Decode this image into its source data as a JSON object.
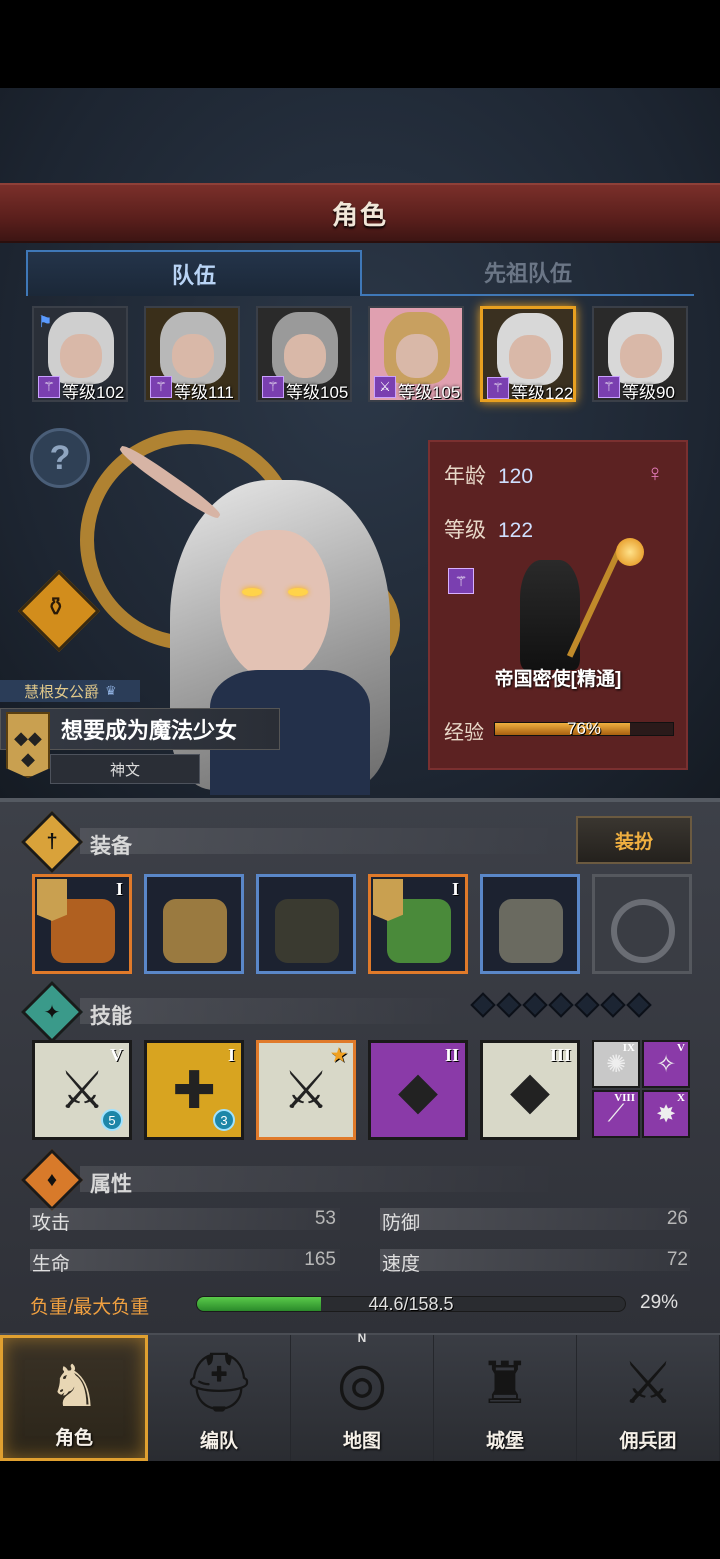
{
  "header": {
    "title": "角色"
  },
  "tabs": [
    {
      "label": "队伍",
      "active": true
    },
    {
      "label": "先祖队伍",
      "active": false
    }
  ],
  "party": [
    {
      "level": "等级102",
      "hair": "#cfcfcf",
      "bg": "#2a2f38",
      "flag": true,
      "class_icon": "staff-icon"
    },
    {
      "level": "等级111",
      "hair": "#b8b8b8",
      "bg": "#3a2f1a",
      "flag": false,
      "class_icon": "staff-icon"
    },
    {
      "level": "等级105",
      "hair": "#9a9a9a",
      "bg": "#2a2a2a",
      "flag": false,
      "class_icon": "staff-icon"
    },
    {
      "level": "等级105",
      "hair": "#c8a060",
      "bg": "#e0a0b0",
      "flag": false,
      "class_icon": "sword-icon"
    },
    {
      "level": "等级122",
      "hair": "#d8d8d8",
      "bg": "#3a3020",
      "flag": false,
      "class_icon": "staff-icon",
      "selected": true
    },
    {
      "level": "等级90",
      "hair": "#d8d8d8",
      "bg": "#2a2a2a",
      "flag": false,
      "class_icon": "staff-icon"
    }
  ],
  "character": {
    "title": "慧根女公爵",
    "trait": "想要成为魔法少女",
    "sub_trait": "神文",
    "age_label": "年龄",
    "age": "120",
    "level_label": "等级",
    "level": "122",
    "gender_icon": "female-icon",
    "job": "帝国密使[精通]",
    "exp_label": "经验",
    "exp_text": "76%",
    "exp_fraction": 0.76
  },
  "equipment": {
    "title": "装备",
    "dress_button": "装扮",
    "slots": [
      {
        "name": "dragon-staff",
        "rarity": "orange",
        "roman": "I",
        "crest": true,
        "color": "#b06020"
      },
      {
        "name": "wooden-crate",
        "rarity": "blue",
        "roman": "",
        "crest": false,
        "color": "#9a7a40"
      },
      {
        "name": "dark-hood",
        "rarity": "blue",
        "roman": "",
        "crest": false,
        "color": "#3a3a30"
      },
      {
        "name": "green-armor",
        "rarity": "orange",
        "roman": "I",
        "crest": true,
        "color": "#4a8a3a"
      },
      {
        "name": "cloth-boots",
        "rarity": "blue",
        "roman": "",
        "crest": false,
        "color": "#6a6a60"
      },
      {
        "name": "empty-ring-slot",
        "rarity": "empty",
        "roman": "",
        "crest": false,
        "color": "#55585e"
      }
    ]
  },
  "skills": {
    "title": "技能",
    "diamond_count": 7,
    "main": [
      {
        "roman": "V",
        "bg": "#d8d8c8",
        "symbol": "⚔",
        "badge": "5"
      },
      {
        "roman": "I",
        "bg": "#d8a420",
        "symbol": "✚",
        "badge": "3"
      },
      {
        "roman": "",
        "bg": "#d8d8c8",
        "symbol": "⚔",
        "badge": "",
        "star": true
      },
      {
        "roman": "II",
        "bg": "#8a3aa8",
        "symbol": "◆",
        "badge": ""
      },
      {
        "roman": "III",
        "bg": "#d8d8c8",
        "symbol": "◆",
        "badge": ""
      }
    ],
    "mini": [
      {
        "roman": "IX",
        "bg": "#c8c8c8",
        "symbol": "✺"
      },
      {
        "roman": "V",
        "bg": "#8a3aa8",
        "symbol": "✧"
      },
      {
        "roman": "VIII",
        "bg": "#8a3aa8",
        "symbol": "⟋"
      },
      {
        "roman": "X",
        "bg": "#8a3aa8",
        "symbol": "✸"
      }
    ]
  },
  "attributes": {
    "title": "属性",
    "attack_label": "攻击",
    "attack": "53",
    "defense_label": "防御",
    "defense": "26",
    "hp_label": "生命",
    "hp": "165",
    "speed_label": "速度",
    "speed": "72",
    "load_label": "负重/最大负重",
    "load_text": "44.6/158.5",
    "load_pct": "29%",
    "load_fraction": 0.29
  },
  "nav": [
    {
      "label": "角色",
      "icon": "knight-icon",
      "active": true
    },
    {
      "label": "编队",
      "icon": "helmet-icon",
      "active": false
    },
    {
      "label": "地图",
      "icon": "compass-icon",
      "active": false
    },
    {
      "label": "城堡",
      "icon": "castle-icon",
      "active": false
    },
    {
      "label": "佣兵团",
      "icon": "mercenary-icon",
      "active": false
    }
  ],
  "compass_n": "N"
}
